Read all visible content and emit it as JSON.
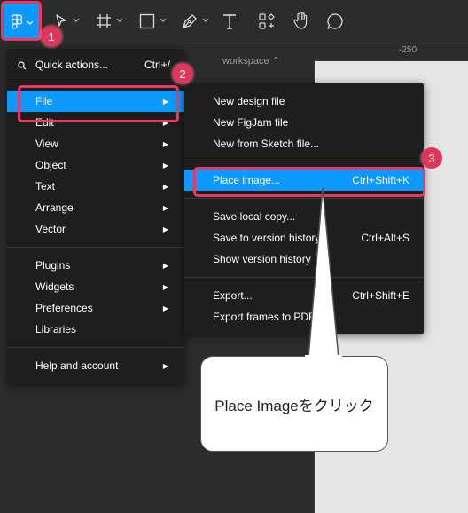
{
  "toolbar": {
    "tools": [
      "main-menu",
      "move",
      "frame",
      "shape",
      "pen",
      "text",
      "resources",
      "hand",
      "comment"
    ]
  },
  "workspace_label": "workspace ⌃",
  "ruler": {
    "top_value": "-250"
  },
  "steps": [
    "1",
    "2",
    "3"
  ],
  "main_menu": {
    "quick_actions": {
      "label": "Quick actions...",
      "shortcut": "Ctrl+/"
    },
    "items": [
      {
        "label": "File",
        "selected": true
      },
      {
        "label": "Edit"
      },
      {
        "label": "View"
      },
      {
        "label": "Object"
      },
      {
        "label": "Text"
      },
      {
        "label": "Arrange"
      },
      {
        "label": "Vector"
      },
      {
        "label": "Plugins"
      },
      {
        "label": "Widgets"
      },
      {
        "label": "Preferences"
      },
      {
        "label": "Libraries"
      },
      {
        "label": "Help and account"
      }
    ]
  },
  "file_menu": {
    "items": [
      {
        "label": "New design file",
        "shortcut": ""
      },
      {
        "label": "New FigJam file",
        "shortcut": ""
      },
      {
        "label": "New from Sketch file...",
        "shortcut": ""
      },
      {
        "label": "Place image...",
        "shortcut": "Ctrl+Shift+K"
      },
      {
        "label": "Save local copy...",
        "shortcut": ""
      },
      {
        "label": "Save to version history...",
        "shortcut": "Ctrl+Alt+S"
      },
      {
        "label": "Show version history",
        "shortcut": ""
      },
      {
        "label": "Export...",
        "shortcut": "Ctrl+Shift+E"
      },
      {
        "label": "Export frames to PDF...",
        "shortcut": ""
      }
    ]
  },
  "callout": {
    "text": "Place Imageをクリック"
  },
  "colors": {
    "accent": "#0d99ff",
    "highlight": "#f0365e",
    "badge": "#e0365a"
  }
}
